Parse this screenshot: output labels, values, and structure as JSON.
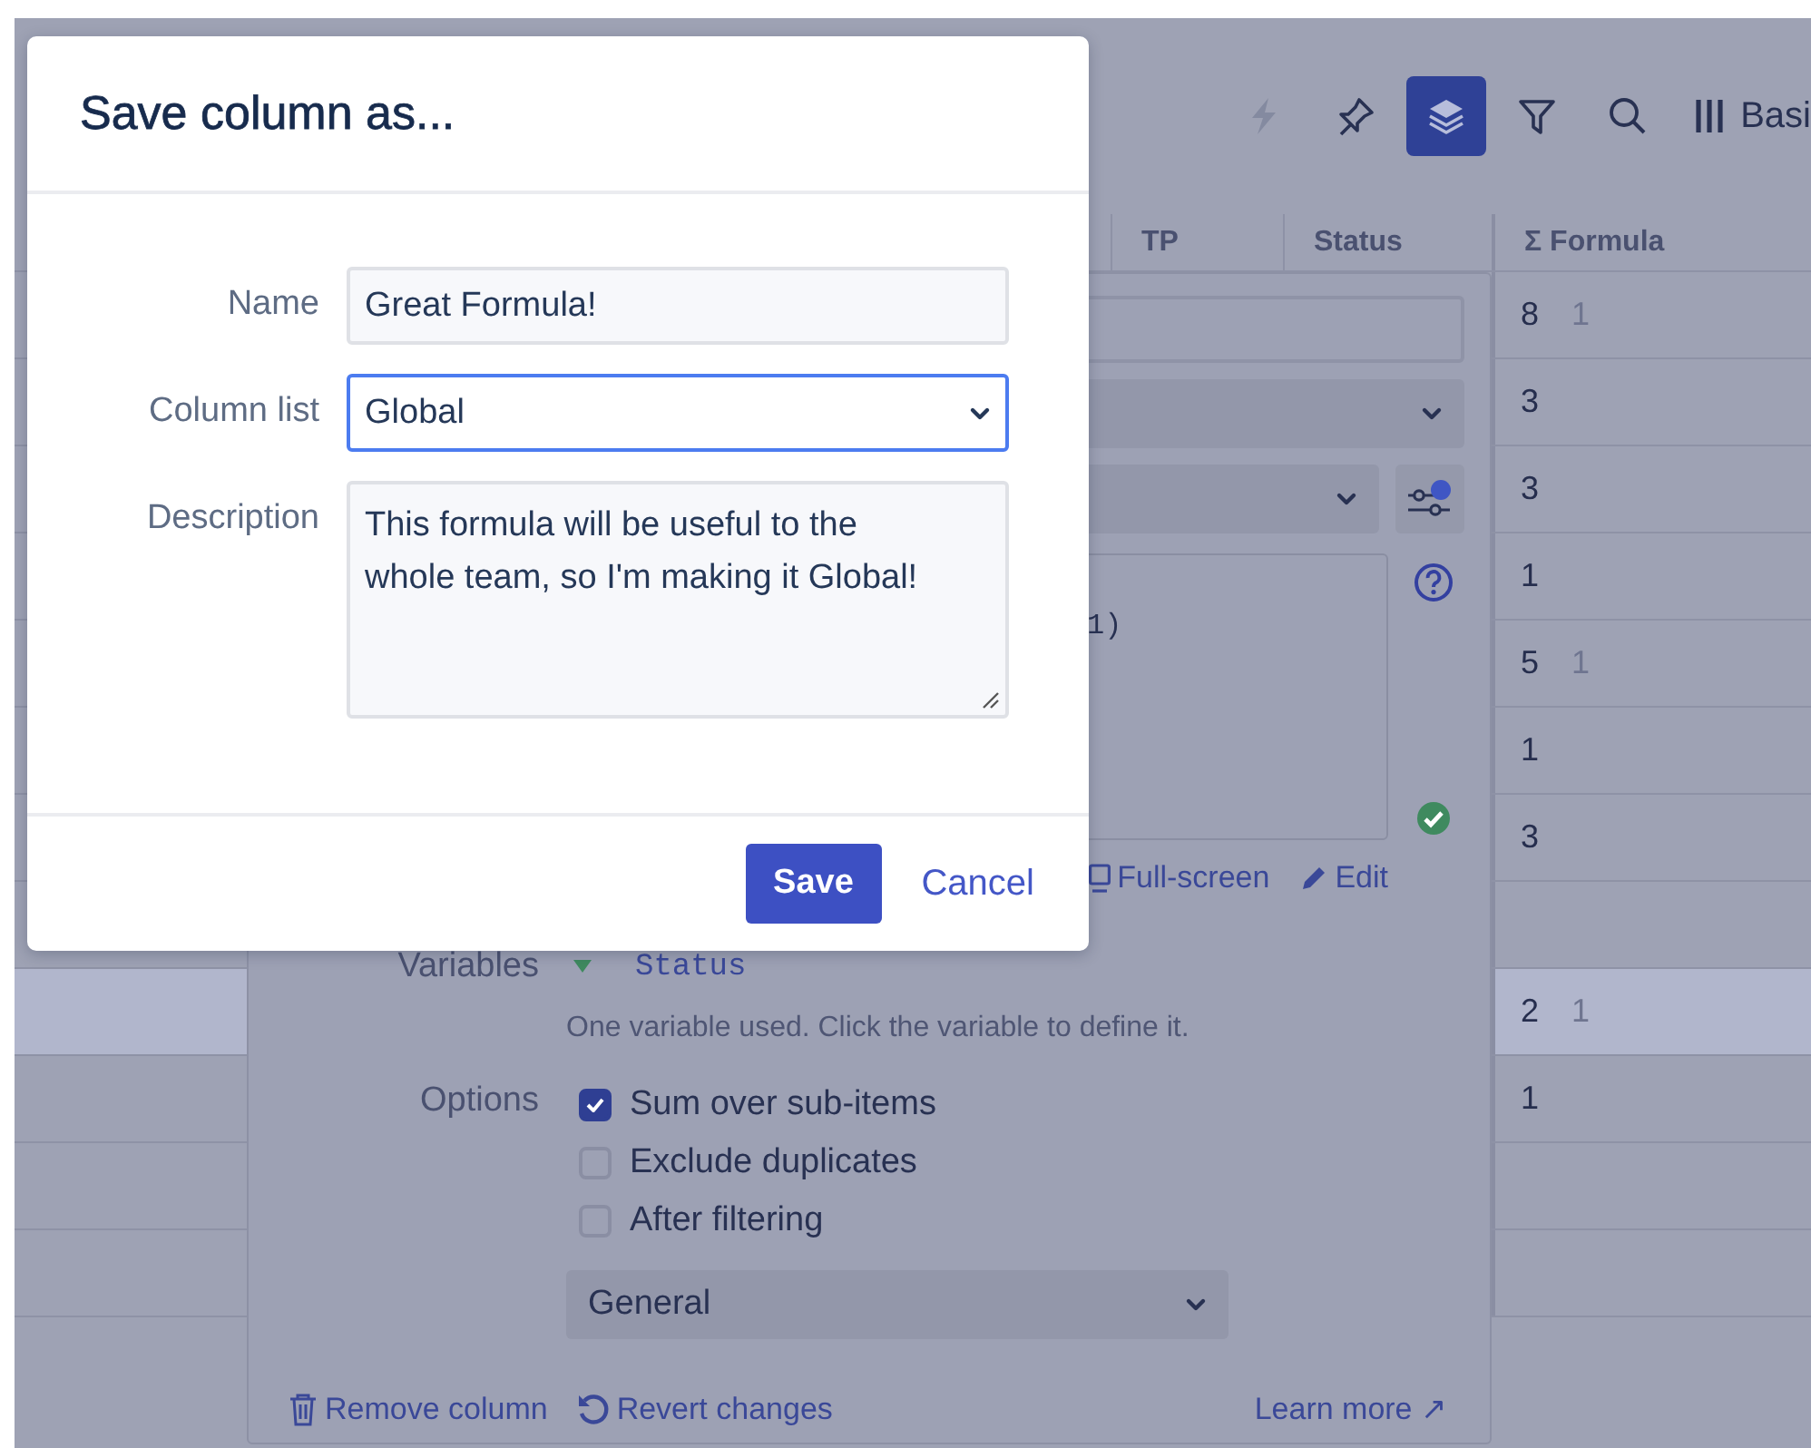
{
  "toolbar": {
    "buttons": [
      {
        "selected": false,
        "disabled": true
      },
      {
        "selected": false,
        "disabled": false
      },
      {
        "selected": true,
        "disabled": false
      },
      {
        "selected": false,
        "disabled": false
      },
      {
        "selected": false,
        "disabled": false
      }
    ],
    "view_label": "Basi"
  },
  "table": {
    "columns": [
      "TP",
      "Status",
      "Σ Formula"
    ],
    "rows": [
      {
        "value": "8",
        "sub": "1",
        "selected": false
      },
      {
        "value": "3",
        "sub": "",
        "selected": false
      },
      {
        "value": "3",
        "sub": "",
        "selected": false
      },
      {
        "value": "1",
        "sub": "",
        "selected": false
      },
      {
        "value": "5",
        "sub": "1",
        "selected": false
      },
      {
        "value": "1",
        "sub": "",
        "selected": false
      },
      {
        "value": "3",
        "sub": "",
        "selected": false
      },
      {
        "value": "",
        "sub": "",
        "selected": false
      },
      {
        "value": "2",
        "sub": "1",
        "selected": true
      },
      {
        "value": "1",
        "sub": "",
        "selected": false
      },
      {
        "value": "",
        "sub": "",
        "selected": false
      },
      {
        "value": "",
        "sub": "",
        "selected": false
      }
    ]
  },
  "column_editor": {
    "formula_excerpt": "1)",
    "formula_valid": true,
    "links": [
      "Full-screen",
      "Edit"
    ],
    "variables_label": "Variables",
    "variables": [
      "Status"
    ],
    "variables_hint": "One variable used. Click the variable to define it.",
    "options_label": "Options",
    "options": [
      {
        "label": "Sum over sub-items",
        "checked": true
      },
      {
        "label": "Exclude duplicates",
        "checked": false
      },
      {
        "label": "After filtering",
        "checked": false
      }
    ],
    "format_select": "General",
    "footer": {
      "remove": "Remove column",
      "revert": "Revert changes",
      "learn_more": "Learn more ↗"
    }
  },
  "dialog": {
    "title": "Save column as...",
    "fields": [
      {
        "kind": "text",
        "label": "Name",
        "value": "Great Formula!",
        "focused": false
      },
      {
        "kind": "select",
        "label": "Column list",
        "value": "Global",
        "focused": true
      },
      {
        "kind": "textarea",
        "label": "Description",
        "value": "This formula will be useful to the whole team, so I'm making it Global!",
        "focused": false
      }
    ],
    "buttons": [
      {
        "kind": "primary",
        "label": "Save"
      },
      {
        "kind": "link",
        "label": "Cancel"
      }
    ]
  }
}
